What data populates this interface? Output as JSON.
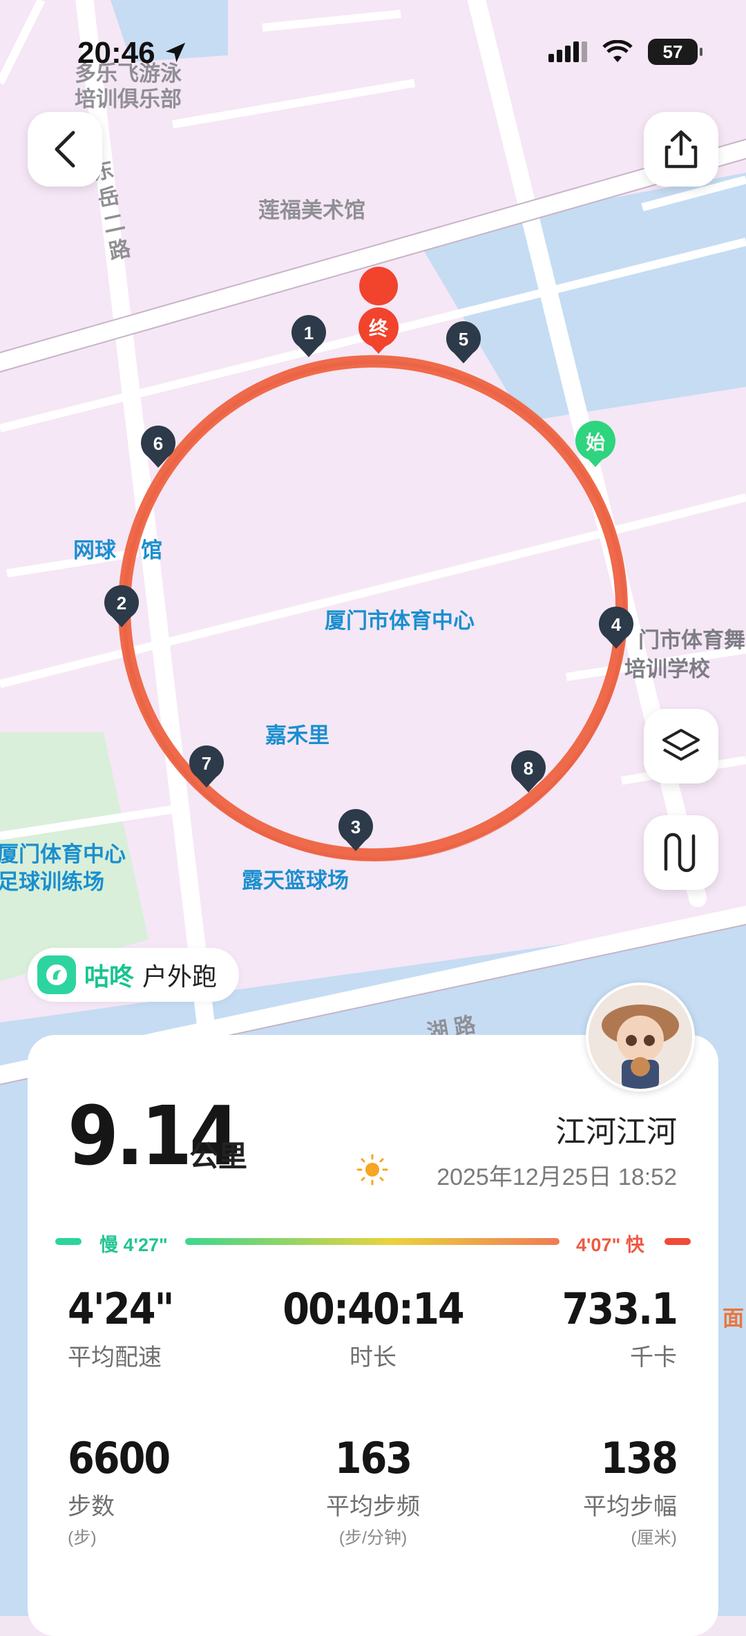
{
  "status_bar": {
    "time": "20:46",
    "battery": "57"
  },
  "map": {
    "labels": {
      "swim_club": "多乐飞游泳\n培训俱乐部",
      "road_dongyue": "东岳二路",
      "art_museum": "莲福美术馆",
      "tennis": "网球",
      "tennis_suffix": "馆",
      "sports_center": "厦门市体育中心",
      "dance_school_1": "门市体育舞",
      "dance_school_2": "培训学校",
      "jiaheli": "嘉禾里",
      "basketball": "露天篮球场",
      "training_field_1": "厦门体育中心",
      "training_field_2": "足球训练场",
      "road_bottom": "湖  路",
      "right_edge": "面"
    },
    "markers": {
      "start": "始",
      "end": "终",
      "km": [
        "1",
        "2",
        "3",
        "4",
        "5",
        "6",
        "7",
        "8"
      ]
    }
  },
  "activity": {
    "app_name": "咕咚",
    "sport_type": "户外跑",
    "distance": "9.14",
    "distance_unit": "公里",
    "username": "江河江河",
    "datetime": "2025年12月25日 18:52",
    "pace_slow": "慢 4'27\"",
    "pace_fast": "4'07\" 快",
    "metrics": {
      "pace": {
        "value": "4'24\"",
        "label": "平均配速"
      },
      "duration": {
        "value": "00:40:14",
        "label": "时长"
      },
      "calories": {
        "value": "733.1",
        "label": "千卡"
      },
      "steps": {
        "value": "6600",
        "label": "步数",
        "unit": "(步)"
      },
      "cadence": {
        "value": "163",
        "label": "平均步频",
        "unit": "(步/分钟)"
      },
      "stride": {
        "value": "138",
        "label": "平均步幅",
        "unit": "(厘米)"
      }
    }
  },
  "colors": {
    "route": "#ef6a4a",
    "brand": "#18c48f",
    "marker": "#2c3a4a"
  },
  "icons": [
    "back-icon",
    "share-icon",
    "layers-icon",
    "route-style-icon",
    "sun-icon",
    "location-arrow-icon",
    "signal-icon",
    "wifi-icon"
  ]
}
